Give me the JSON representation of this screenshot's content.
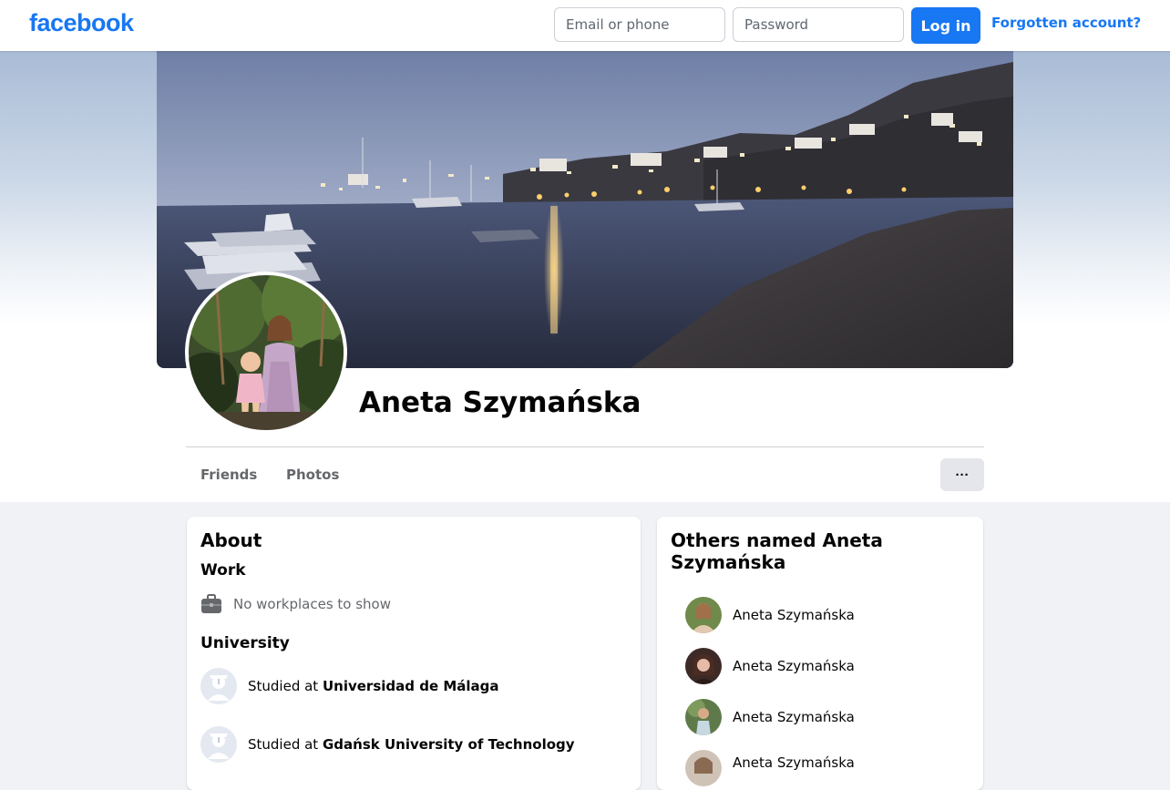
{
  "topbar": {
    "logo": "facebook",
    "email_placeholder": "Email or phone",
    "password_placeholder": "Password",
    "login_label": "Log in",
    "forgot_label": "Forgotten account?"
  },
  "profile": {
    "name": "Aneta Szymańska",
    "tabs": [
      "Friends",
      "Photos"
    ],
    "more_label": "···"
  },
  "about": {
    "title": "About",
    "work_title": "Work",
    "work_empty": "No workplaces to show",
    "university_title": "University",
    "studied_prefix": "Studied at",
    "universities": [
      "Universidad de Málaga",
      "Gdańsk University of Technology"
    ]
  },
  "others": {
    "title": "Others named Aneta Szymańska",
    "people": [
      "Aneta Szymańska",
      "Aneta Szymańska",
      "Aneta Szymańska",
      "Aneta Szymańska"
    ]
  },
  "colors": {
    "brand": "#1877f2",
    "page_bg": "#f0f2f5"
  },
  "icons": [
    "briefcase-icon",
    "graduation-icon",
    "more-icon"
  ]
}
